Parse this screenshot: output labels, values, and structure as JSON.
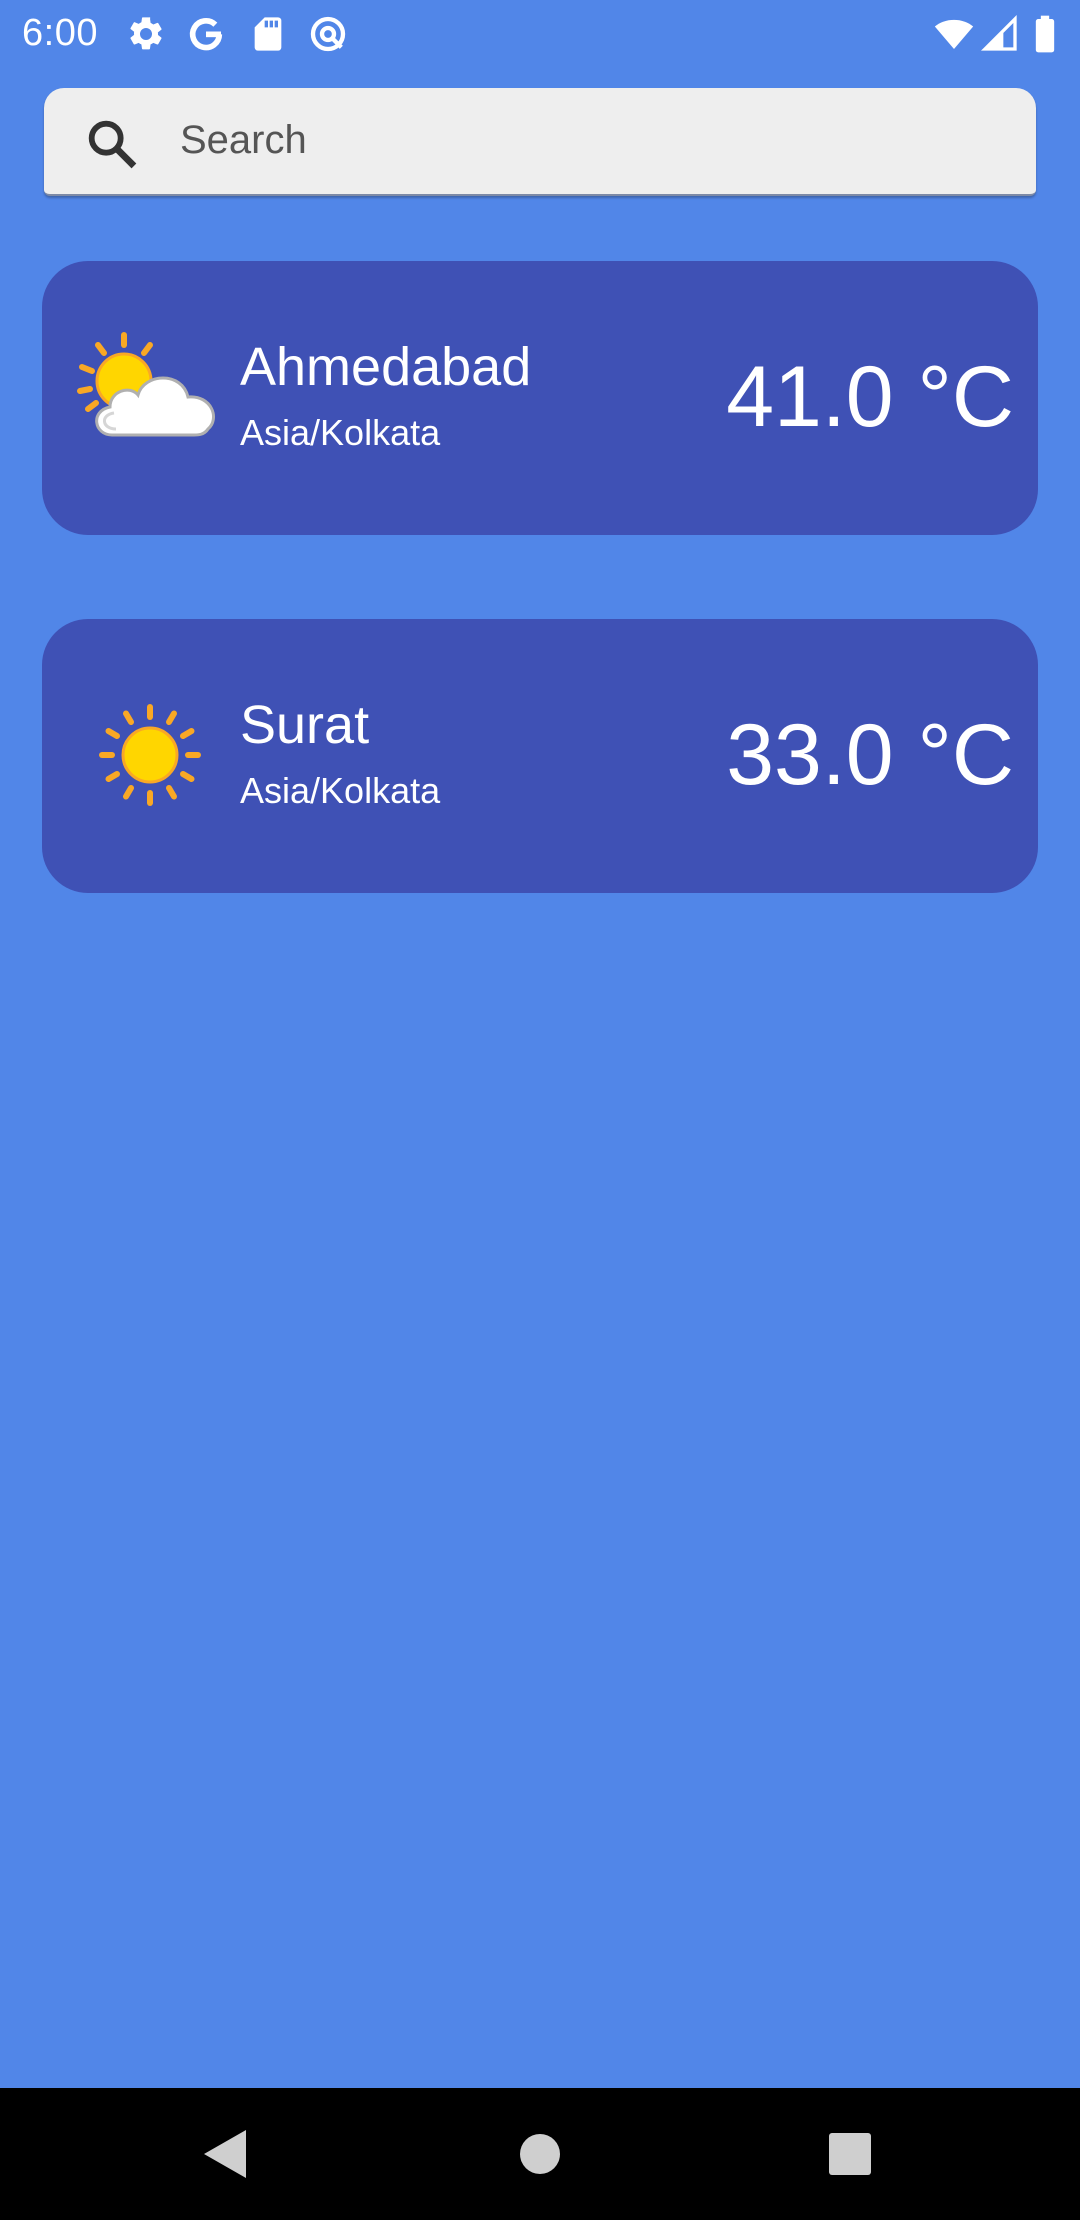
{
  "status_bar": {
    "time": "6:00",
    "left_icons": [
      "gear-icon",
      "google-g-icon",
      "sd-card-icon",
      "vpn-at-icon"
    ],
    "right_icons": [
      "wifi-icon",
      "cell-signal-icon",
      "battery-icon"
    ]
  },
  "search": {
    "placeholder": "Search",
    "value": "",
    "icon": "search-icon"
  },
  "cities": [
    {
      "name": "Ahmedabad",
      "timezone": "Asia/Kolkata",
      "temperature": "41.0 °C",
      "icon": "partly-cloudy-icon"
    },
    {
      "name": "Surat",
      "timezone": "Asia/Kolkata",
      "temperature": "33.0 °C",
      "icon": "sunny-icon"
    }
  ],
  "nav_bar": {
    "buttons": [
      "back-icon",
      "home-icon",
      "recents-icon"
    ]
  },
  "colors": {
    "background": "#5186E8",
    "card": "#3F51B5",
    "search_field": "#EEEEEE",
    "nav_bar": "#000000",
    "text_on_card": "#FFFFFF",
    "sun": "#FFD600",
    "sun_rays": "#F9A825"
  }
}
